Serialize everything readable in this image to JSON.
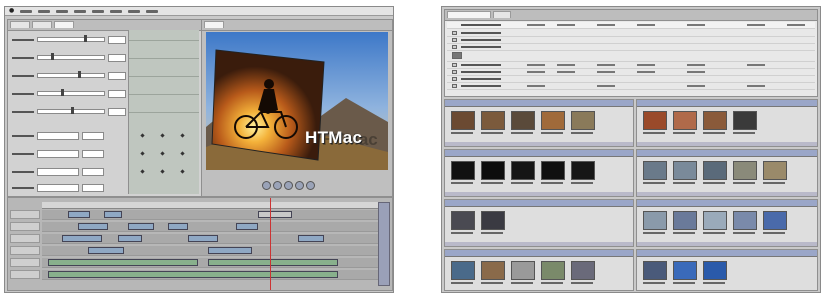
{
  "left_app": {
    "viewer": {
      "watermark": "HTMac"
    }
  },
  "colors": {
    "window_gray": "#c9c9c9",
    "timeline_clip_blue": "#8fa8c4",
    "timeline_clip_green": "#88b08c",
    "bin_title_bar": "#9aa6c8",
    "playhead": "#cc3333"
  }
}
